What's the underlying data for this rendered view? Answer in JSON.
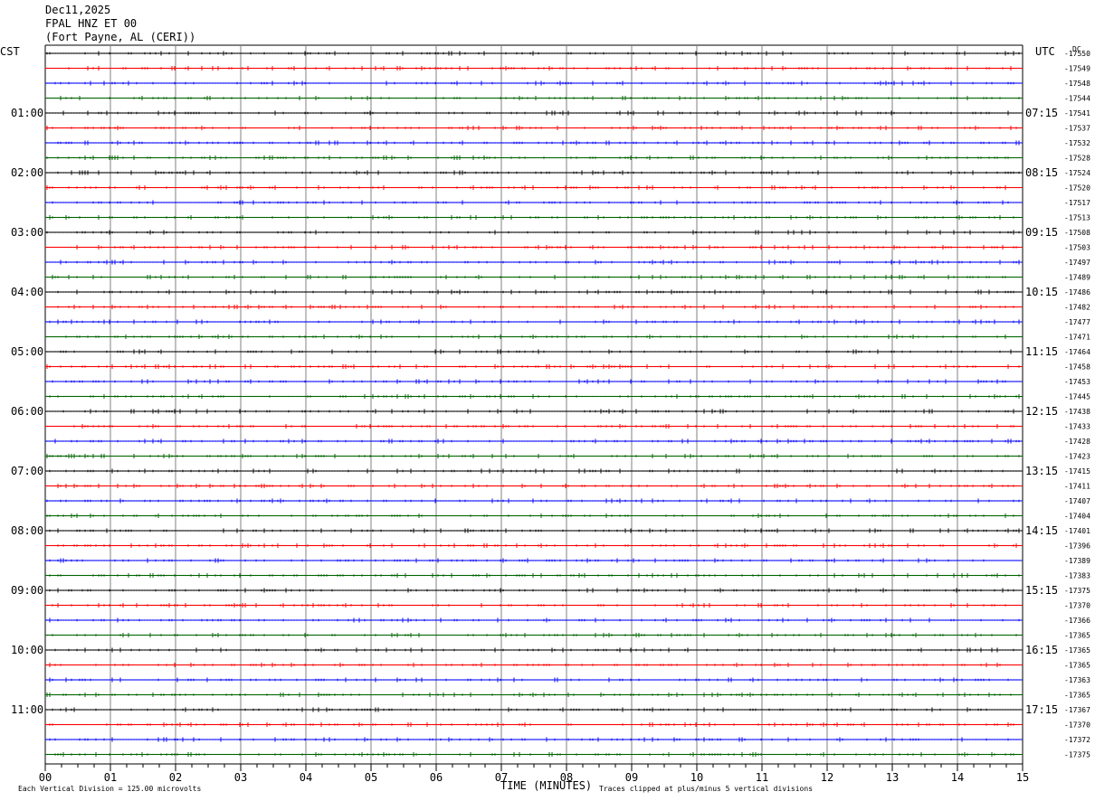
{
  "header": {
    "date": "Dec11,2025",
    "station": "FPAL HNZ ET 00",
    "location": "(Fort Payne, AL (CERI))"
  },
  "left_axis_label": "CST",
  "right_axis_label": "UTC",
  "right_axis_unit": "DC",
  "footer": {
    "scale_note": "Each Vertical Division =  125.00 microvolts",
    "clip_note": "Traces clipped at plus/minus 5 vertical divisions"
  },
  "colors": {
    "black": "#000000",
    "red": "#ff0000",
    "blue": "#0000ff",
    "green": "#006400",
    "grid": "#808080"
  },
  "chart_data": {
    "type": "line",
    "title": "",
    "xlabel": "TIME (MINUTES)",
    "ylabel": "",
    "xlim": [
      0,
      15
    ],
    "x_tick_labels": [
      "00",
      "01",
      "02",
      "03",
      "04",
      "05",
      "06",
      "07",
      "08",
      "09",
      "10",
      "11",
      "12",
      "13",
      "14",
      "15"
    ],
    "trace_count": 48,
    "trace_colors": [
      "black",
      "red",
      "blue",
      "green"
    ],
    "cst_hour_labels": [
      "01:00",
      "02:00",
      "03:00",
      "04:00",
      "05:00",
      "06:00",
      "07:00",
      "08:00",
      "09:00",
      "10:00",
      "11:00"
    ],
    "utc_hour_labels": [
      "07:15",
      "08:15",
      "09:15",
      "10:15",
      "11:15",
      "12:15",
      "13:15",
      "14:15",
      "15:15",
      "16:15",
      "17:15"
    ],
    "dc_offsets": [
      -17550,
      -17549,
      -17548,
      -17544,
      -17541,
      -17537,
      -17532,
      -17528,
      -17524,
      -17520,
      -17517,
      -17513,
      -17508,
      -17503,
      -17497,
      -17489,
      -17486,
      -17482,
      -17477,
      -17471,
      -17464,
      -17458,
      -17453,
      -17445,
      -17438,
      -17433,
      -17428,
      -17423,
      -17415,
      -17411,
      -17407,
      -17404,
      -17401,
      -17396,
      -17389,
      -17383,
      -17375,
      -17370,
      -17366,
      -17365,
      -17365,
      -17365,
      -17363,
      -17365,
      -17367,
      -17370,
      -17372,
      -17375
    ]
  }
}
